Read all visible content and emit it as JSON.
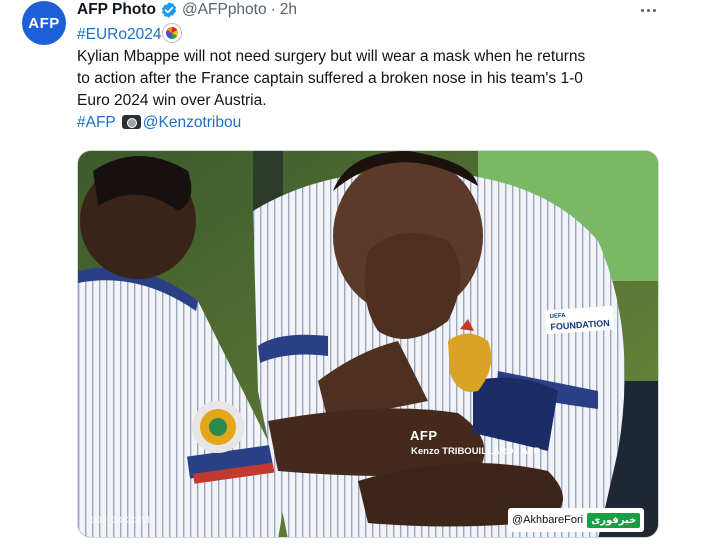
{
  "account": {
    "avatar_text": "AFP",
    "name": "AFP Photo",
    "handle": "@AFPphoto",
    "separator": "·",
    "time": "2h",
    "verified": true
  },
  "tweet": {
    "hashtag_top": "#EURo2024",
    "body_line1": "Kylian Mbappe will not need surgery but will wear a mask when he returns",
    "body_line2": "to action after the France captain suffered a broken nose in his team's 1-0",
    "body_line3": "Euro 2024 win over Austria.",
    "hashtag_afp": "#AFP",
    "photographer_mention": "@Kenzotribou"
  },
  "media": {
    "watermark_logo": "AFP",
    "watermark_credit": "Kenzo TRIBOUILLARD / AFP",
    "image_id": "000_34XC3VE",
    "source_handle": "@AkhbareFori",
    "source_logo": "خبرفوری",
    "shirt_badge_line1": "UEFA",
    "shirt_badge_line2": "FOUNDATION"
  },
  "colors": {
    "link": "#1d70c4",
    "verified": "#1d9bf0",
    "avatar_bg": "#1d5fd6",
    "muted": "#536471"
  },
  "icons": [
    "verified-badge-icon",
    "more-options-icon",
    "trophy-emoji-icon",
    "camera-emoji-icon"
  ]
}
